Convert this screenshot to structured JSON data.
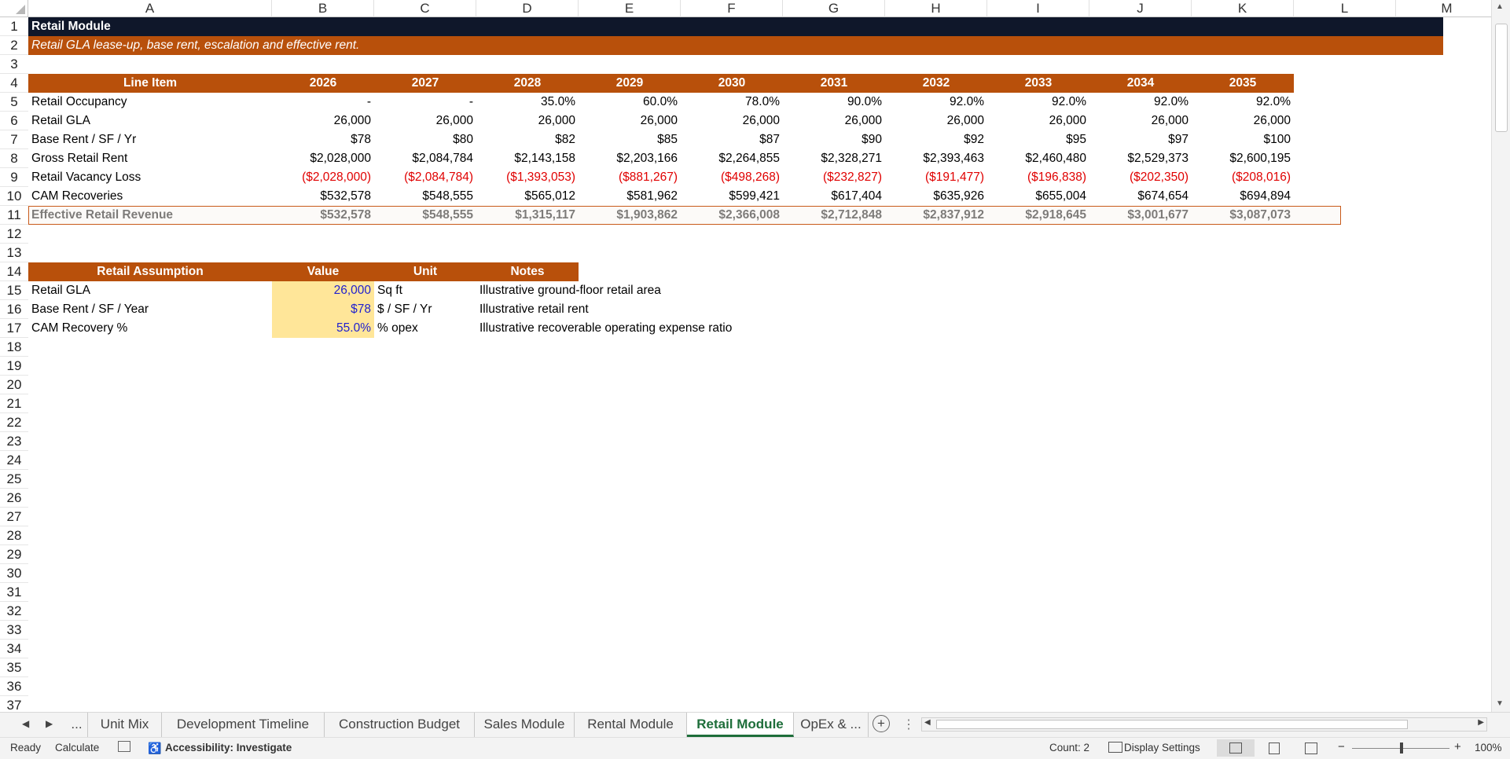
{
  "columns": [
    "A",
    "B",
    "C",
    "D",
    "E",
    "F",
    "G",
    "H",
    "I",
    "J",
    "K",
    "L",
    "M"
  ],
  "title_row": {
    "text": "Retail Module",
    "fill": "#0f172a"
  },
  "subtitle_row": {
    "text": "Retail GLA lease-up, base rent, escalation and effective rent.",
    "fill": "#b8500b"
  },
  "header_fill": "#b8500b",
  "table": {
    "headers": [
      "Line Item",
      "2026",
      "2027",
      "2028",
      "2029",
      "2030",
      "2031",
      "2032",
      "2033",
      "2034",
      "2035"
    ],
    "rows": [
      {
        "label": "Retail Occupancy",
        "values": [
          "-",
          "-",
          "35.0%",
          "60.0%",
          "78.0%",
          "90.0%",
          "92.0%",
          "92.0%",
          "92.0%",
          "92.0%"
        ]
      },
      {
        "label": "Retail GLA",
        "values": [
          "26,000",
          "26,000",
          "26,000",
          "26,000",
          "26,000",
          "26,000",
          "26,000",
          "26,000",
          "26,000",
          "26,000"
        ]
      },
      {
        "label": "Base Rent / SF / Yr",
        "values": [
          "$78",
          "$80",
          "$82",
          "$85",
          "$87",
          "$90",
          "$92",
          "$95",
          "$97",
          "$100"
        ]
      },
      {
        "label": "Gross Retail Rent",
        "values": [
          "$2,028,000",
          "$2,084,784",
          "$2,143,158",
          "$2,203,166",
          "$2,264,855",
          "$2,328,271",
          "$2,393,463",
          "$2,460,480",
          "$2,529,373",
          "$2,600,195"
        ]
      },
      {
        "label": "Retail Vacancy Loss",
        "values": [
          "($2,028,000)",
          "($2,084,784)",
          "($1,393,053)",
          "($881,267)",
          "($498,268)",
          "($232,827)",
          "($191,477)",
          "($196,838)",
          "($202,350)",
          "($208,016)"
        ]
      },
      {
        "label": "CAM Recoveries",
        "values": [
          "$532,578",
          "$548,555",
          "$565,012",
          "$581,962",
          "$599,421",
          "$617,404",
          "$635,926",
          "$655,004",
          "$674,654",
          "$694,894"
        ]
      },
      {
        "label": "Effective Retail Revenue",
        "values": [
          "$532,578",
          "$548,555",
          "$1,315,117",
          "$1,903,862",
          "$2,366,008",
          "$2,712,848",
          "$2,837,912",
          "$2,918,645",
          "$3,001,677",
          "$3,087,073"
        ]
      }
    ]
  },
  "assumptions": {
    "headers": [
      "Retail Assumption",
      "Value",
      "Unit",
      "Notes"
    ],
    "input_fill": "#ffe699",
    "rows": [
      {
        "label": "Retail GLA",
        "value": "26,000",
        "unit": "Sq ft",
        "note": "Illustrative ground-floor retail area"
      },
      {
        "label": "Base Rent / SF / Year",
        "value": "$78",
        "unit": "$ / SF / Yr",
        "note": "Illustrative retail rent"
      },
      {
        "label": "CAM Recovery %",
        "value": "55.0%",
        "unit": "% opex",
        "note": "Illustrative recoverable operating expense ratio"
      }
    ]
  },
  "sheet_tabs": [
    "...",
    "Unit Mix",
    "Development Timeline",
    "Construction Budget",
    "Sales Module",
    "Rental Module",
    "Retail Module",
    "OpEx & ..."
  ],
  "active_tab": "Retail Module",
  "status": {
    "ready": "Ready",
    "calculate": "Calculate",
    "accessibility": "Accessibility: Investigate",
    "count": "Count: 2",
    "display_settings": "Display Settings",
    "zoom": "100%"
  },
  "icons": {
    "add_sheet": "plus-circle-icon",
    "prev": "caret-left-icon",
    "next": "caret-right-icon"
  }
}
